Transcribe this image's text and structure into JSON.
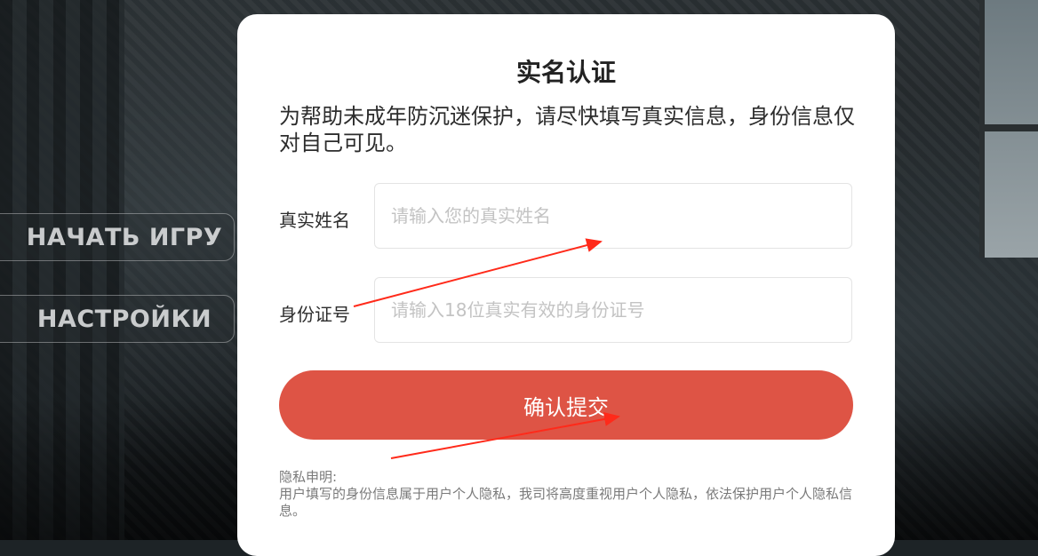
{
  "menu": {
    "start_label": "НАЧАТЬ ИГРУ",
    "settings_label": "НАСТРОЙКИ"
  },
  "dialog": {
    "title": "实名认证",
    "description": "为帮助未成年防沉迷保护，请尽快填写真实信息，身份信息仅对自己可见。",
    "name_label": "真实姓名",
    "name_placeholder": "请输入您的真实姓名",
    "id_label": "身份证号",
    "id_placeholder": "请输入18位真实有效的身份证号",
    "submit_label": "确认提交",
    "privacy_title": "隐私申明:",
    "privacy_text": "用户填写的身份信息属于用户个人隐私，我司将高度重视用户个人隐私，依法保护用户个人隐私信息。"
  },
  "colors": {
    "accent": "#de5445",
    "annotation": "#ff2a1a"
  }
}
